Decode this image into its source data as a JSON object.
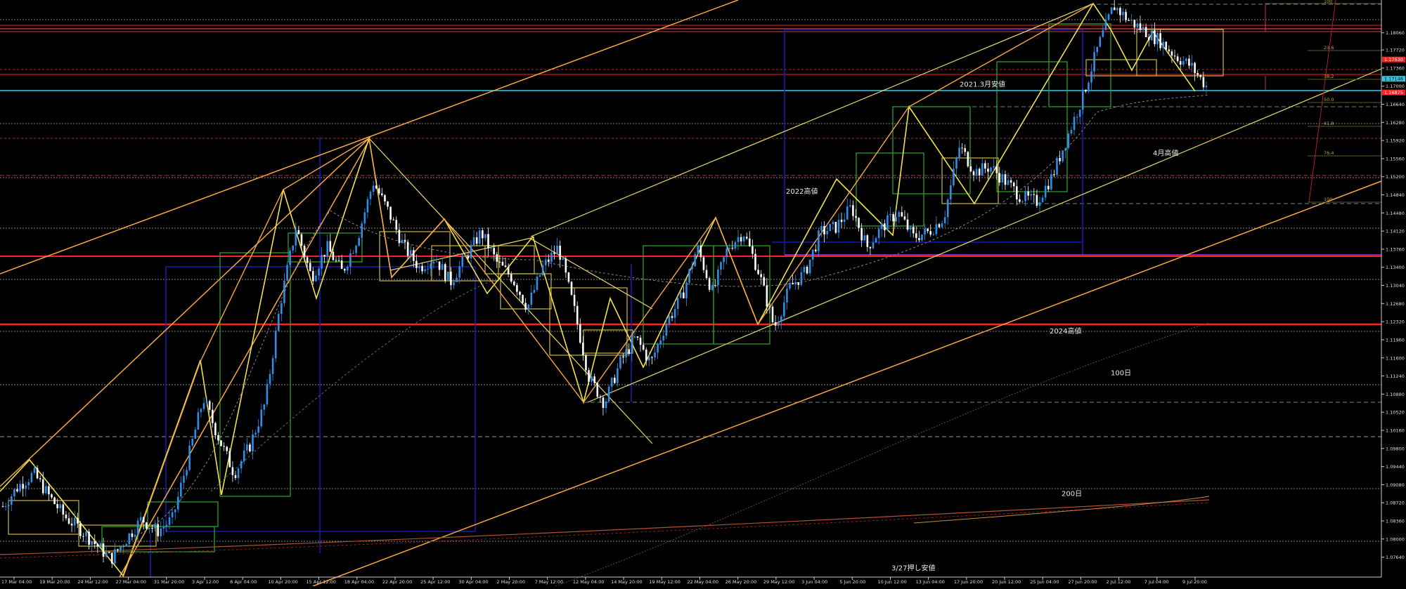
{
  "chart_data": {
    "type": "candlestick",
    "title": "",
    "xlabel": "",
    "ylabel": "",
    "ylim": [
      1.073,
      1.186
    ],
    "grid": false,
    "y_ticks": [
      "1.18060",
      "1.17720",
      "1.17360",
      "1.17000",
      "1.16640",
      "1.16280",
      "1.15920",
      "1.15560",
      "1.15200",
      "1.14840",
      "1.14480",
      "1.14120",
      "1.13760",
      "1.13400",
      "1.13040",
      "1.12680",
      "1.12320",
      "1.11960",
      "1.11600",
      "1.11240",
      "1.10880",
      "1.10520",
      "1.10160",
      "1.09800",
      "1.09440",
      "1.09080",
      "1.08720",
      "1.08360",
      "1.08000",
      "1.07640"
    ],
    "x_ticks": [
      "17 Mar 04:00",
      "19 Mar 20:00",
      "24 Mar 12:00",
      "27 Mar 04:00",
      "31 Mar 20:00",
      "3 Apr 12:00",
      "8 Apr 04:00",
      "10 Apr 20:00",
      "15 Apr 12:00",
      "18 Apr 04:00",
      "22 Apr 20:00",
      "25 Apr 12:00",
      "30 Apr 04:00",
      "2 May 20:00",
      "7 May 12:00",
      "12 May 04:00",
      "14 May 20:00",
      "19 May 12:00",
      "22 May 04:00",
      "26 May 20:00",
      "29 May 12:00",
      "3 Jun 04:00",
      "5 Jun 20:00",
      "10 Jun 12:00",
      "13 Jun 04:00",
      "17 Jun 20:00",
      "20 Jun 12:00",
      "25 Jun 04:00",
      "27 Jun 20:00",
      "2 Jul 12:00",
      "7 Jul 04:00",
      "9 Jul 20:00"
    ],
    "price_path": [
      1.0865,
      1.0905,
      1.093,
      1.0885,
      1.0845,
      1.082,
      1.079,
      1.076,
      1.08,
      1.084,
      1.0815,
      1.084,
      1.096,
      1.108,
      1.1,
      1.093,
      1.0985,
      1.107,
      1.127,
      1.142,
      1.132,
      1.138,
      1.133,
      1.14,
      1.151,
      1.145,
      1.138,
      1.134,
      1.136,
      1.131,
      1.136,
      1.141,
      1.135,
      1.132,
      1.126,
      1.134,
      1.138,
      1.126,
      1.112,
      1.107,
      1.115,
      1.12,
      1.115,
      1.123,
      1.128,
      1.138,
      1.129,
      1.138,
      1.141,
      1.133,
      1.122,
      1.13,
      1.133,
      1.141,
      1.142,
      1.146,
      1.138,
      1.142,
      1.145,
      1.14,
      1.141,
      1.144,
      1.158,
      1.153,
      1.154,
      1.151,
      1.148,
      1.147,
      1.152,
      1.16,
      1.168,
      1.178,
      1.186,
      1.183,
      1.181,
      1.179,
      1.176,
      1.174,
      1.17
    ],
    "horizontal_labels": [
      {
        "text": "2021.3月安値",
        "price": 1.1703
      },
      {
        "text": "4月高値",
        "price": 1.1566
      },
      {
        "text": "2022高値",
        "price": 1.149
      },
      {
        "text": "2024高値",
        "price": 1.1213
      },
      {
        "text": "100日",
        "price": 1.113
      },
      {
        "text": "200日",
        "price": 1.089
      },
      {
        "text": "3/27押し安値",
        "price": 1.0742
      }
    ],
    "fib_labels": [
      "100",
      "23.6",
      "38.2",
      "50.0",
      "61.8",
      "76.4",
      "100"
    ],
    "highlighted_prices": [
      "1.17530",
      "1.17146",
      "1.16875"
    ],
    "colors": {
      "background": "#000000",
      "candle": "#2f8fe8",
      "channel": "#f5a742",
      "zigzag": "#f0e04a",
      "trend_lines": "#e8d76a",
      "box_green": "#2ea82e",
      "box_blue": "#1a1ab8",
      "red_level": "#ff2020",
      "cyan_level": "#30d0e0"
    }
  }
}
